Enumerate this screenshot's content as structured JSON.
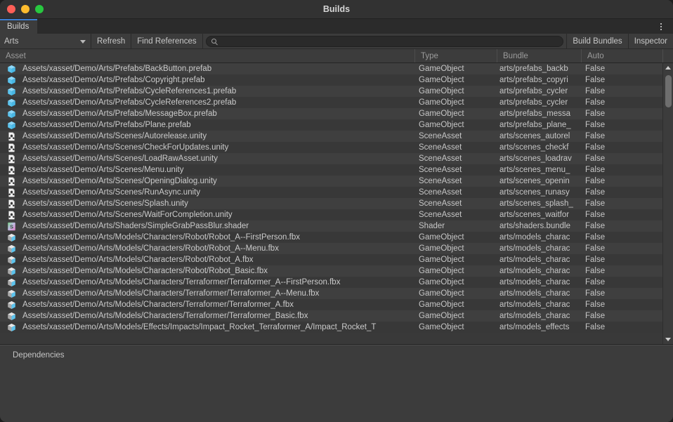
{
  "window": {
    "title": "Builds",
    "traffic_lights": [
      "close-button",
      "minimize-button",
      "zoom-button"
    ]
  },
  "tabs": [
    {
      "label": "Builds",
      "active": true
    }
  ],
  "kebab_menu": {
    "name": "window-options-menu",
    "icon": "kebab-vertical-icon"
  },
  "toolbar": {
    "group_dropdown": {
      "value": "Arts",
      "icon": "chevron-down-icon"
    },
    "refresh_label": "Refresh",
    "find_references_label": "Find References",
    "search": {
      "value": "",
      "placeholder": "",
      "icon": "search-icon"
    },
    "build_bundles_label": "Build Bundles",
    "inspector_label": "Inspector"
  },
  "columns": [
    {
      "key": "asset",
      "label": "Asset"
    },
    {
      "key": "type",
      "label": "Type"
    },
    {
      "key": "bundle",
      "label": "Bundle"
    },
    {
      "key": "auto",
      "label": "Auto"
    }
  ],
  "rows": [
    {
      "icon": "prefab-icon",
      "asset": "Assets/xasset/Demo/Arts/Prefabs/BackButton.prefab",
      "type": "GameObject",
      "bundle": "arts/prefabs_backb",
      "auto": "False"
    },
    {
      "icon": "prefab-icon",
      "asset": "Assets/xasset/Demo/Arts/Prefabs/Copyright.prefab",
      "type": "GameObject",
      "bundle": "arts/prefabs_copyri",
      "auto": "False"
    },
    {
      "icon": "prefab-icon",
      "asset": "Assets/xasset/Demo/Arts/Prefabs/CycleReferences1.prefab",
      "type": "GameObject",
      "bundle": "arts/prefabs_cycler",
      "auto": "False"
    },
    {
      "icon": "prefab-icon",
      "asset": "Assets/xasset/Demo/Arts/Prefabs/CycleReferences2.prefab",
      "type": "GameObject",
      "bundle": "arts/prefabs_cycler",
      "auto": "False"
    },
    {
      "icon": "prefab-icon",
      "asset": "Assets/xasset/Demo/Arts/Prefabs/MessageBox.prefab",
      "type": "GameObject",
      "bundle": "arts/prefabs_messa",
      "auto": "False"
    },
    {
      "icon": "prefab-icon",
      "asset": "Assets/xasset/Demo/Arts/Prefabs/Plane.prefab",
      "type": "GameObject",
      "bundle": "arts/prefabs_plane_",
      "auto": "False"
    },
    {
      "icon": "scene-icon",
      "asset": "Assets/xasset/Demo/Arts/Scenes/Autorelease.unity",
      "type": "SceneAsset",
      "bundle": "arts/scenes_autorel",
      "auto": "False"
    },
    {
      "icon": "scene-icon",
      "asset": "Assets/xasset/Demo/Arts/Scenes/CheckForUpdates.unity",
      "type": "SceneAsset",
      "bundle": "arts/scenes_checkf",
      "auto": "False"
    },
    {
      "icon": "scene-icon",
      "asset": "Assets/xasset/Demo/Arts/Scenes/LoadRawAsset.unity",
      "type": "SceneAsset",
      "bundle": "arts/scenes_loadrav",
      "auto": "False"
    },
    {
      "icon": "scene-icon",
      "asset": "Assets/xasset/Demo/Arts/Scenes/Menu.unity",
      "type": "SceneAsset",
      "bundle": "arts/scenes_menu_",
      "auto": "False"
    },
    {
      "icon": "scene-icon",
      "asset": "Assets/xasset/Demo/Arts/Scenes/OpeningDialog.unity",
      "type": "SceneAsset",
      "bundle": "arts/scenes_openin",
      "auto": "False"
    },
    {
      "icon": "scene-icon",
      "asset": "Assets/xasset/Demo/Arts/Scenes/RunAsync.unity",
      "type": "SceneAsset",
      "bundle": "arts/scenes_runasy",
      "auto": "False"
    },
    {
      "icon": "scene-icon",
      "asset": "Assets/xasset/Demo/Arts/Scenes/Splash.unity",
      "type": "SceneAsset",
      "bundle": "arts/scenes_splash_",
      "auto": "False"
    },
    {
      "icon": "scene-icon",
      "asset": "Assets/xasset/Demo/Arts/Scenes/WaitForCompletion.unity",
      "type": "SceneAsset",
      "bundle": "arts/scenes_waitfor",
      "auto": "False"
    },
    {
      "icon": "shader-icon",
      "asset": "Assets/xasset/Demo/Arts/Shaders/SimpleGrabPassBlur.shader",
      "type": "Shader",
      "bundle": "arts/shaders.bundle",
      "auto": "False"
    },
    {
      "icon": "model-icon",
      "asset": "Assets/xasset/Demo/Arts/Models/Characters/Robot/Robot_A--FirstPerson.fbx",
      "type": "GameObject",
      "bundle": "arts/models_charac",
      "auto": "False"
    },
    {
      "icon": "model-icon",
      "asset": "Assets/xasset/Demo/Arts/Models/Characters/Robot/Robot_A--Menu.fbx",
      "type": "GameObject",
      "bundle": "arts/models_charac",
      "auto": "False"
    },
    {
      "icon": "model-icon",
      "asset": "Assets/xasset/Demo/Arts/Models/Characters/Robot/Robot_A.fbx",
      "type": "GameObject",
      "bundle": "arts/models_charac",
      "auto": "False"
    },
    {
      "icon": "model-icon",
      "asset": "Assets/xasset/Demo/Arts/Models/Characters/Robot/Robot_Basic.fbx",
      "type": "GameObject",
      "bundle": "arts/models_charac",
      "auto": "False"
    },
    {
      "icon": "model-icon",
      "asset": "Assets/xasset/Demo/Arts/Models/Characters/Terraformer/Terraformer_A--FirstPerson.fbx",
      "type": "GameObject",
      "bundle": "arts/models_charac",
      "auto": "False"
    },
    {
      "icon": "model-icon",
      "asset": "Assets/xasset/Demo/Arts/Models/Characters/Terraformer/Terraformer_A--Menu.fbx",
      "type": "GameObject",
      "bundle": "arts/models_charac",
      "auto": "False"
    },
    {
      "icon": "model-icon",
      "asset": "Assets/xasset/Demo/Arts/Models/Characters/Terraformer/Terraformer_A.fbx",
      "type": "GameObject",
      "bundle": "arts/models_charac",
      "auto": "False"
    },
    {
      "icon": "model-icon",
      "asset": "Assets/xasset/Demo/Arts/Models/Characters/Terraformer/Terraformer_Basic.fbx",
      "type": "GameObject",
      "bundle": "arts/models_charac",
      "auto": "False"
    },
    {
      "icon": "model-icon",
      "asset": "Assets/xasset/Demo/Arts/Models/Effects/Impacts/Impact_Rocket_Terraformer_A/Impact_Rocket_T",
      "type": "GameObject",
      "bundle": "arts/models_effects",
      "auto": "False"
    }
  ],
  "scrollbar": {
    "up_arrow": "scroll-up-arrow",
    "down_arrow": "scroll-down-arrow",
    "thumb": "scroll-thumb"
  },
  "bottom_panel": {
    "label": "Dependencies"
  },
  "colors": {
    "accent": "#3d7fd1",
    "window_bg": "#3c3c3c",
    "row_odd": "#3f3f3f",
    "row_even": "#383838",
    "text": "#cbcbcb",
    "header_text": "#9b9b9b"
  }
}
